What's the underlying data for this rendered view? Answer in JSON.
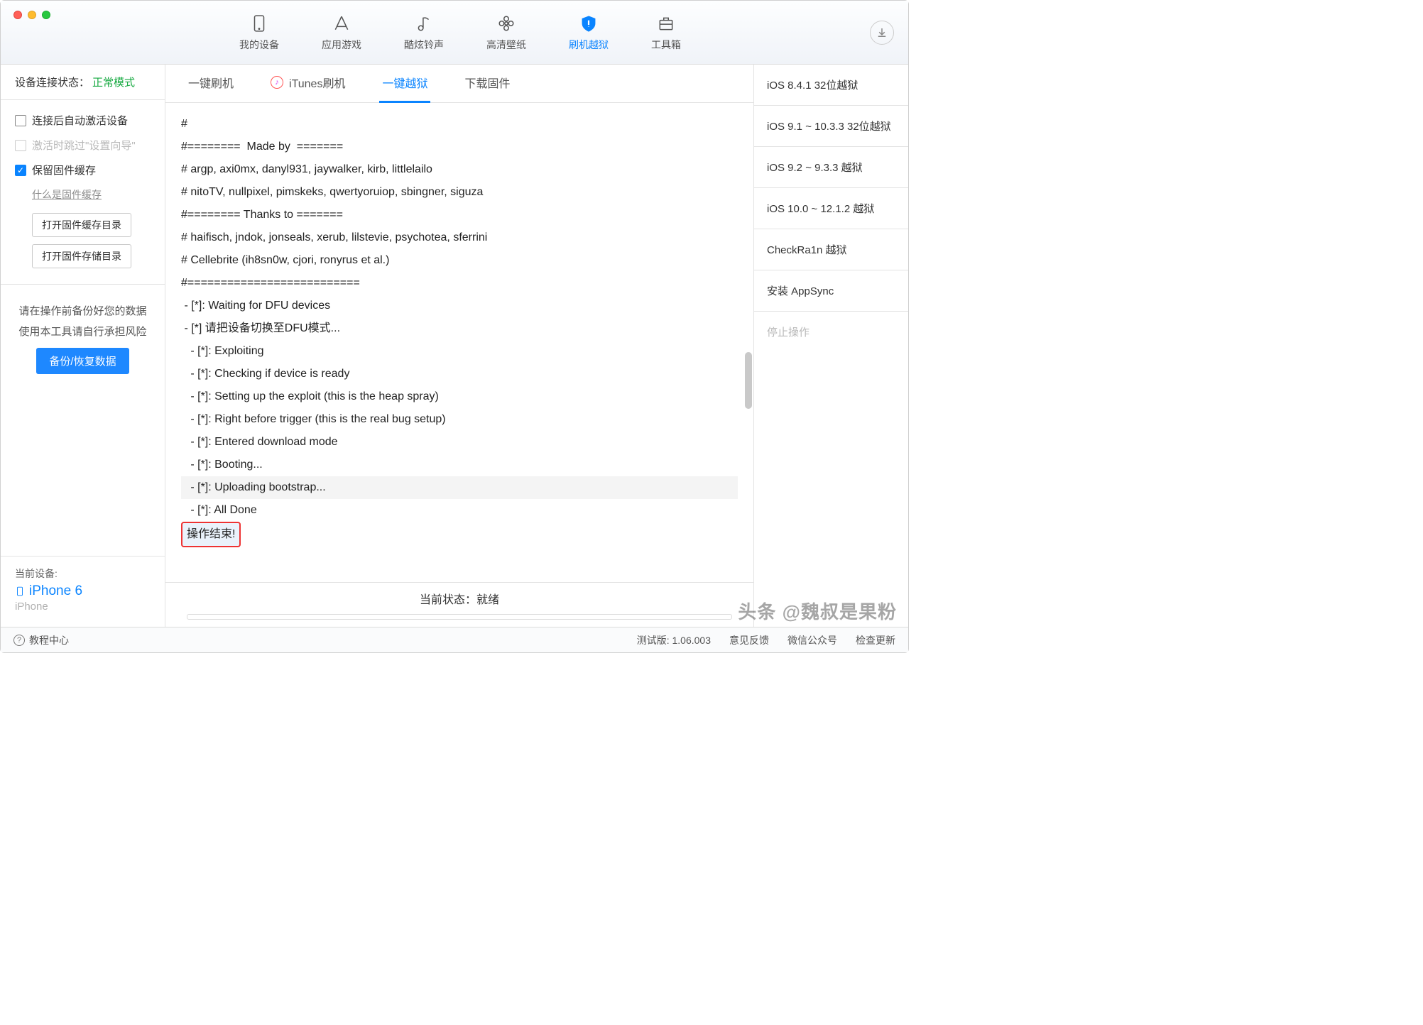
{
  "nav": {
    "items": [
      {
        "label": "我的设备",
        "name": "nav-devices"
      },
      {
        "label": "应用游戏",
        "name": "nav-apps"
      },
      {
        "label": "酷炫铃声",
        "name": "nav-ringtones"
      },
      {
        "label": "高清壁纸",
        "name": "nav-wallpapers"
      },
      {
        "label": "刷机越狱",
        "name": "nav-flash-jailbreak",
        "active": true
      },
      {
        "label": "工具箱",
        "name": "nav-toolbox"
      }
    ]
  },
  "left": {
    "status_label": "设备连接状态：",
    "status_value": "正常模式",
    "opt_auto_activate": "连接后自动激活设备",
    "opt_skip_setup": "激活时跳过\"设置向导\"",
    "opt_keep_cache": "保留固件缓存",
    "help_cache": "什么是固件缓存",
    "btn_open_cache": "打开固件缓存目录",
    "btn_open_store": "打开固件存储目录",
    "warn1": "请在操作前备份好您的数据",
    "warn2": "使用本工具请自行承担风险",
    "backup_btn": "备份/恢复数据",
    "cur_label": "当前设备:",
    "cur_name": "iPhone 6",
    "cur_type": "iPhone"
  },
  "subtabs": [
    {
      "label": "一键刷机"
    },
    {
      "label": "iTunes刷机",
      "itunes": true
    },
    {
      "label": "一键越狱",
      "active": true
    },
    {
      "label": "下载固件"
    }
  ],
  "log_lines": [
    "#",
    "#========  Made by  =======",
    "# argp, axi0mx, danyl931, jaywalker, kirb, littlelailo",
    "# nitoTV, nullpixel, pimskeks, qwertyoruiop, sbingner, siguza",
    "#======== Thanks to =======",
    "# haifisch, jndok, jonseals, xerub, lilstevie, psychotea, sferrini",
    "# Cellebrite (ih8sn0w, cjori, ronyrus et al.)",
    "#==========================",
    "",
    " - [*]: Waiting for DFU devices",
    " - [*] 请把设备切换至DFU模式...",
    "   - [*]: Exploiting",
    "   - [*]: Checking if device is ready",
    "   - [*]: Setting up the exploit (this is the heap spray)",
    "   - [*]: Right before trigger (this is the real bug setup)",
    "   - [*]: Entered download mode",
    "   - [*]: Booting...",
    "   - [*]: Uploading bootstrap...",
    "   - [*]: All Done"
  ],
  "log_done": "操作结束!",
  "status": {
    "label": "当前状态：",
    "value": "就绪"
  },
  "right": [
    "iOS 8.4.1 32位越狱",
    "iOS 9.1 ~ 10.3.3 32位越狱",
    "iOS 9.2 ~ 9.3.3 越狱",
    "iOS 10.0 ~ 12.1.2 越狱",
    "CheckRa1n 越狱",
    "安装 AppSync"
  ],
  "right_stop": "停止操作",
  "footer": {
    "help": "教程中心",
    "version": "测试版: 1.06.003",
    "links": [
      "意见反馈",
      "微信公众号",
      "检查更新"
    ]
  },
  "watermark": "头条 @魏叔是果粉"
}
